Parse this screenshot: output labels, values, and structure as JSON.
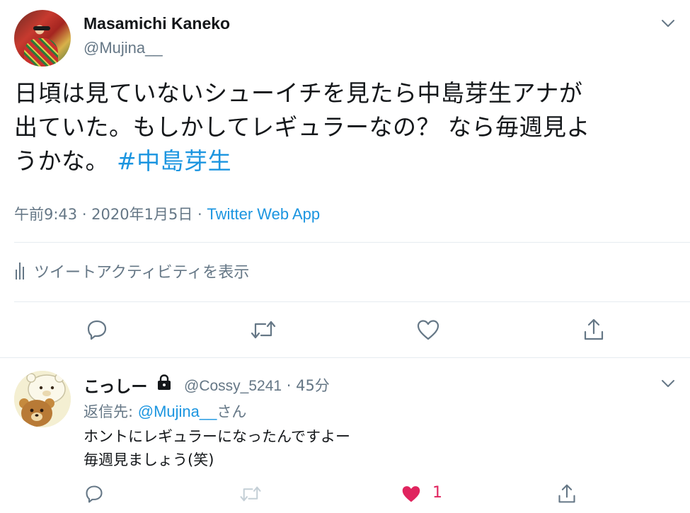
{
  "main_tweet": {
    "display_name": "Masamichi Kaneko",
    "handle": "@Mujina__",
    "text_line1": "日頃は見ていないシューイチを見たら中島芽生アナが",
    "text_line2": "出ていた。もしかしてレギュラーなの？ なら毎週見よ",
    "text_line3": "うかな。 ",
    "hashtag": "#中島芽生",
    "timestamp": "午前9:43 · 2020年1月5日 · ",
    "source": "Twitter Web App",
    "activity_label": "ツイートアクティビティを表示"
  },
  "reply_tweet": {
    "display_name": "こっしー",
    "handle": "@Cossy_5241",
    "time": " · 45分",
    "reply_to_prefix": "返信先: ",
    "reply_to_mention": "@Mujina__",
    "reply_to_suffix": "さん",
    "text_line1": "ホントにレギュラーになったんですよー",
    "text_line2": "毎週見ましょう(笑)",
    "like_count": "1"
  },
  "colors": {
    "link": "#1b95e0",
    "secondary": "#657786",
    "like": "#e0245e"
  }
}
